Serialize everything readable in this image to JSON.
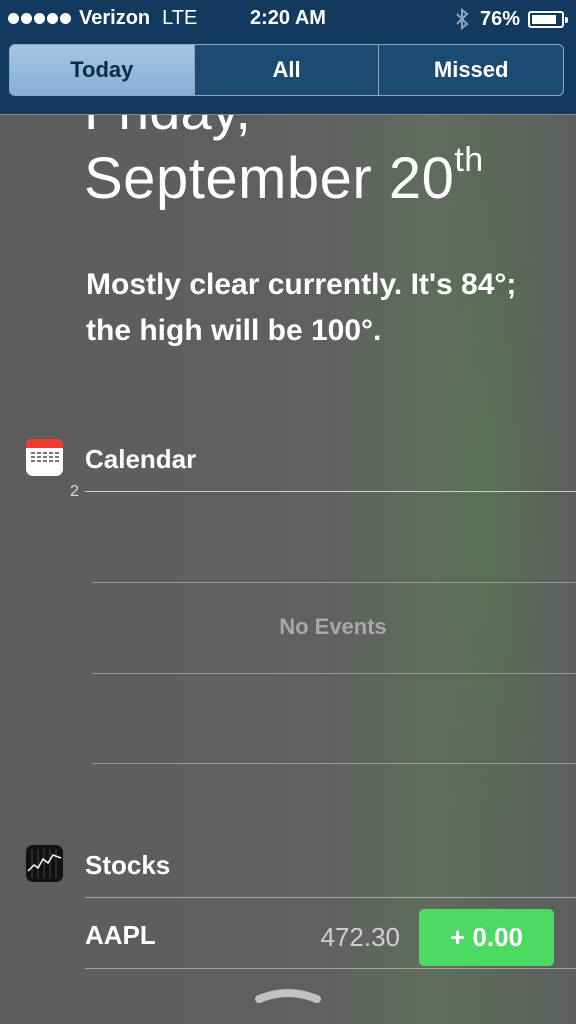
{
  "status_bar": {
    "carrier": "Verizon",
    "network": "LTE",
    "time": "2:20 AM",
    "battery": "76%",
    "battery_level": 0.76,
    "icons": [
      "signal-dots-icon",
      "bluetooth-icon",
      "battery-icon"
    ]
  },
  "tabs": [
    {
      "label": "Today",
      "active": true
    },
    {
      "label": "All",
      "active": false
    },
    {
      "label": "Missed",
      "active": false
    }
  ],
  "today": {
    "day_name": "Friday,",
    "date_main": "September 20",
    "date_suffix": "th",
    "weather": "Mostly clear currently. It's 84°; the high will be 100°."
  },
  "calendar": {
    "title": "Calendar",
    "hour_label": "2",
    "empty_text": "No Events",
    "icon": "calendar-icon"
  },
  "stocks": {
    "title": "Stocks",
    "icon": "stocks-icon",
    "rows": [
      {
        "symbol": "AAPL",
        "price": "472.30",
        "change": "+ 0.00",
        "change_color": "#4cd964"
      }
    ]
  },
  "colors": {
    "status_bar_bg": "#123a5e",
    "accent": "#86aed6",
    "positive": "#4cd964",
    "calendar_red": "#ef3b30"
  }
}
